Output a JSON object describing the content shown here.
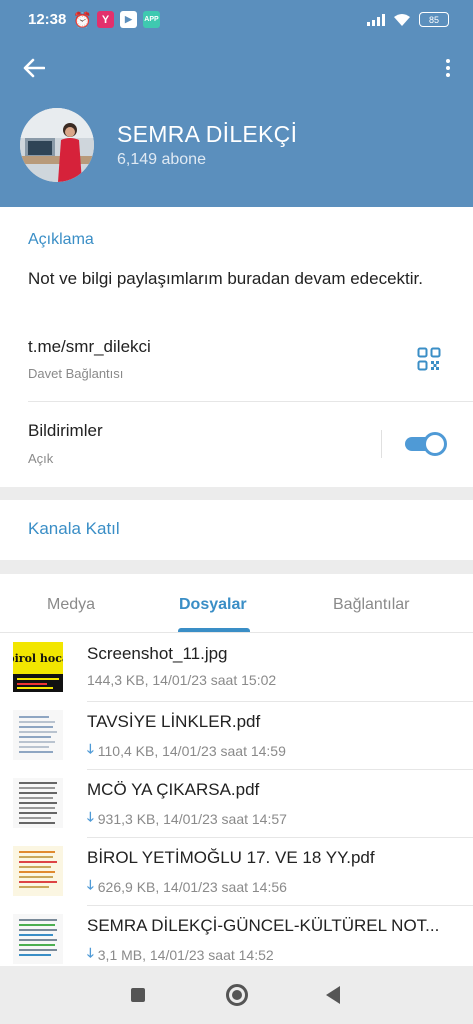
{
  "status_bar": {
    "time": "12:38",
    "battery": "85",
    "notification_icons": [
      "alarm-icon",
      "yandex-icon",
      "youtube-icon",
      "app-icon"
    ],
    "y_label": "Y",
    "youtube_label": "▶",
    "app_label": "APP"
  },
  "header": {
    "channel_title": "SEMRA DİLEKÇİ",
    "subscribers": "6,149 abone",
    "background_color": "#5b8fbd"
  },
  "info": {
    "section_title": "Açıklama",
    "description": "Not ve bilgi paylaşımlarım buradan devam edecektir.",
    "link": "t.me/smr_dilekci",
    "link_caption": "Davet Bağlantısı",
    "notifications_label": "Bildirimler",
    "notifications_status": "Açık",
    "notifications_on": true
  },
  "join": {
    "label": "Kanala Katıl"
  },
  "tabs": {
    "items": [
      "Medya",
      "Dosyalar",
      "Bağlantılar"
    ],
    "active": "Dosyalar"
  },
  "files": [
    {
      "name": "Screenshot_11.jpg",
      "meta": "144,3 KB, 14/01/23 saat 15:02",
      "download_icon": false,
      "thumb_label": "birol hoca"
    },
    {
      "name": "TAVSİYE LİNKLER.pdf",
      "meta": "110,4 KB, 14/01/23 saat 14:59",
      "download_icon": true
    },
    {
      "name": "MCÖ YA ÇIKARSA.pdf",
      "meta": "931,3 KB, 14/01/23 saat 14:57",
      "download_icon": true
    },
    {
      "name": "BİROL YETİMOĞLU 17. VE 18 YY.pdf",
      "meta": "626,9 KB, 14/01/23 saat 14:56",
      "download_icon": true
    },
    {
      "name": "SEMRA DİLEKÇİ-GÜNCEL-KÜLTÜREL NOT...",
      "meta": "3,1 MB, 14/01/23 saat 14:52",
      "download_icon": true
    }
  ],
  "colors": {
    "accent": "#3a8ec6",
    "toggle": "#4f9ad6"
  }
}
